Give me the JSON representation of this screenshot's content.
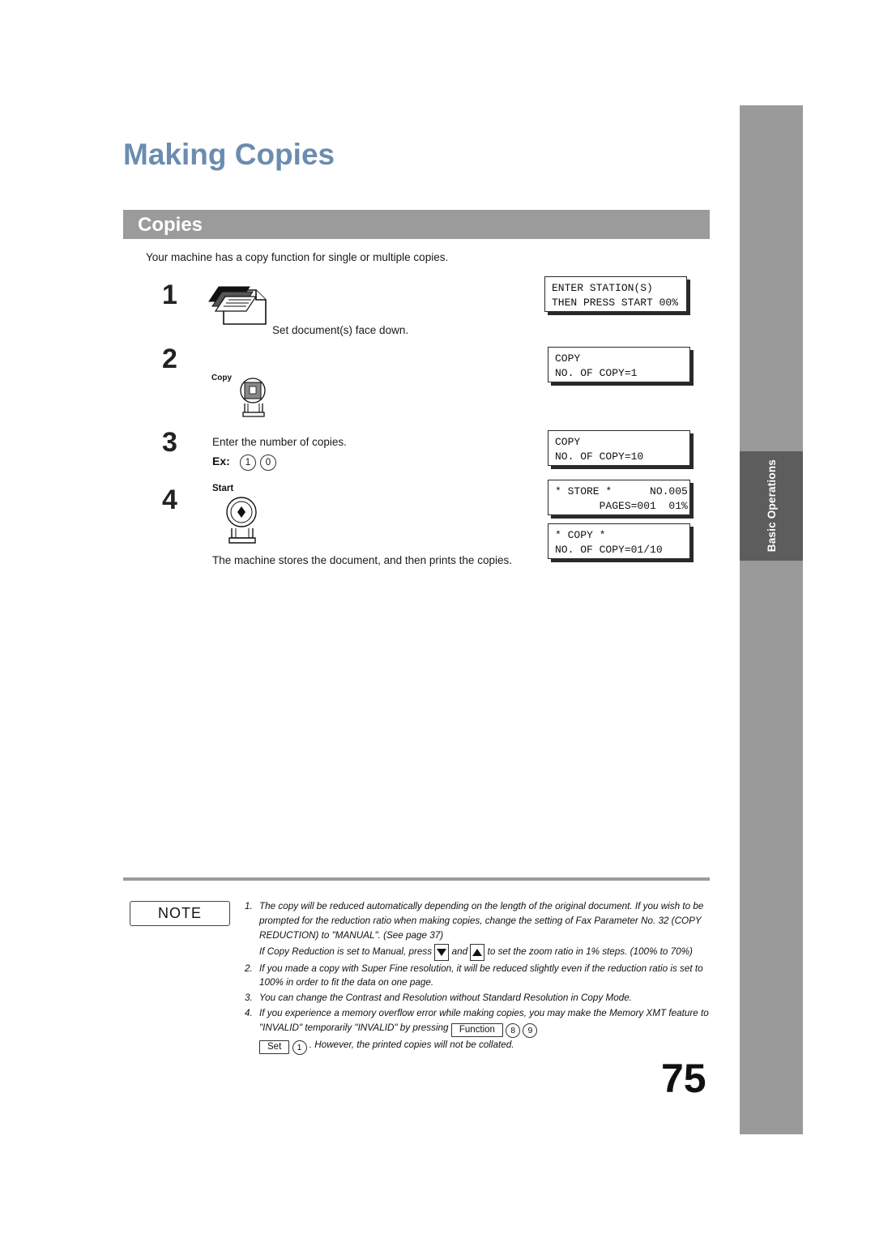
{
  "page": {
    "title": "Making Copies",
    "section_title": "Copies",
    "intro": "Your machine has a copy function for single or multiple copies.",
    "page_number": "75",
    "side_tab_label": "Basic Operations"
  },
  "steps": [
    {
      "number": "1",
      "text": "Set document(s) face down."
    },
    {
      "number": "2",
      "key_label": "Copy"
    },
    {
      "number": "3",
      "text": "Enter the number of copies.",
      "example_label": "Ex:",
      "example_keys": [
        "1",
        "0"
      ]
    },
    {
      "number": "4",
      "key_label": "Start",
      "text": "The machine stores the document, and then prints the copies."
    }
  ],
  "displays": [
    {
      "line1": "ENTER STATION(S)",
      "line2": "THEN PRESS START 00%"
    },
    {
      "line1": "COPY",
      "line2": "NO. OF COPY=1"
    },
    {
      "line1": "COPY",
      "line2": "NO. OF COPY=10"
    },
    {
      "line1": "* STORE *      NO.005",
      "line2": "       PAGES=001  01%"
    },
    {
      "line1": "* COPY *",
      "line2": "NO. OF COPY=01/10"
    }
  ],
  "note": {
    "label": "NOTE",
    "items": [
      {
        "number": "1.",
        "text": "The copy will be reduced automatically depending on the length of the original document. If you wish to be prompted for the reduction ratio when making copies, change the setting of Fax Parameter No. 32 (COPY REDUCTION) to \"MANUAL\".  (See page 37)",
        "sub_a": "If Copy Reduction is set to Manual, press",
        "sub_b": "and",
        "sub_c": "to set the zoom ratio in 1% steps. (100% to 70%)"
      },
      {
        "number": "2.",
        "text": "If you made a copy with Super Fine resolution, it will be reduced slightly even if the reduction ratio is set to 100% in order to fit the data on one page."
      },
      {
        "number": "3.",
        "text": "You can change the Contrast and Resolution without Standard Resolution in Copy Mode."
      },
      {
        "number": "4.",
        "text": "If you experience a memory overflow error while making copies, you may make the Memory XMT feature to \"INVALID\" temporarily \"INVALID\" by pressing",
        "key_function": "Function",
        "key_8": "8",
        "key_9": "9",
        "key_set": "Set",
        "key_1": "1",
        "text_tail": ". However, the printed copies will not be collated."
      }
    ]
  }
}
